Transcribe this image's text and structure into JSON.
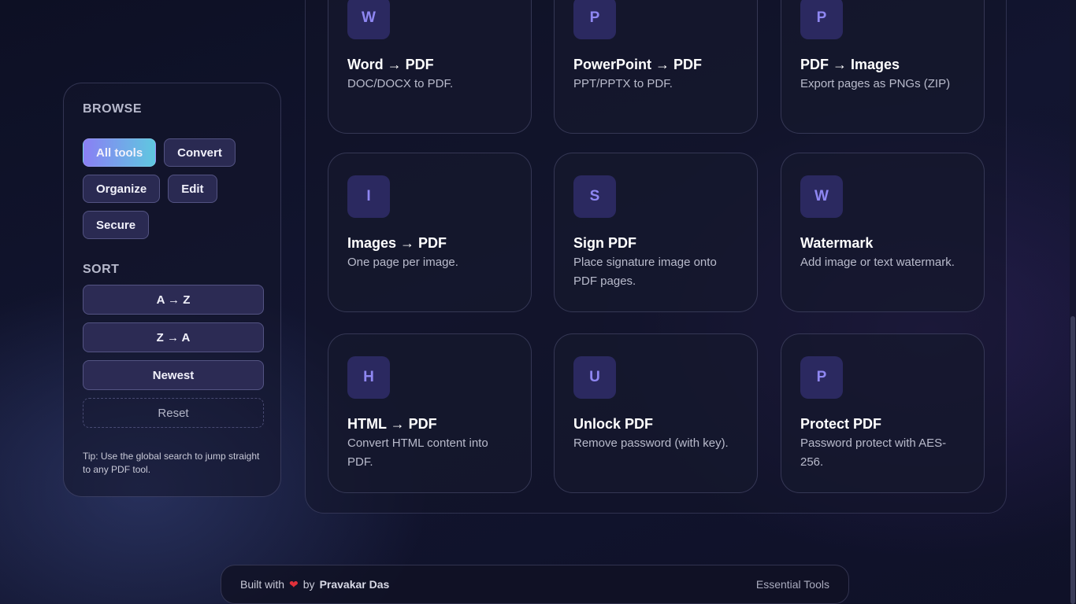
{
  "sidebar": {
    "browse_title": "BROWSE",
    "filters": [
      {
        "label": "All tools",
        "active": true
      },
      {
        "label": "Convert",
        "active": false
      },
      {
        "label": "Organize",
        "active": false
      },
      {
        "label": "Edit",
        "active": false
      },
      {
        "label": "Secure",
        "active": false
      }
    ],
    "sort_title": "SORT",
    "sort_az": "A → Z",
    "sort_za": "Z → A",
    "sort_newest": "Newest",
    "reset": "Reset",
    "tip": "Tip: Use the global search to jump straight to any PDF tool."
  },
  "tools": [
    {
      "letter": "W",
      "title": "Word → PDF",
      "desc": "DOC/DOCX to PDF."
    },
    {
      "letter": "P",
      "title": "PowerPoint → PDF",
      "desc": "PPT/PPTX to PDF."
    },
    {
      "letter": "P",
      "title": "PDF → Images",
      "desc": "Export pages as PNGs (ZIP)"
    },
    {
      "letter": "I",
      "title": "Images → PDF",
      "desc": "One page per image."
    },
    {
      "letter": "S",
      "title": "Sign PDF",
      "desc": "Place signature image onto PDF pages."
    },
    {
      "letter": "W",
      "title": "Watermark",
      "desc": "Add image or text watermark."
    },
    {
      "letter": "H",
      "title": "HTML → PDF",
      "desc": "Convert HTML content into PDF."
    },
    {
      "letter": "U",
      "title": "Unlock PDF",
      "desc": "Remove password (with key)."
    },
    {
      "letter": "P",
      "title": "Protect PDF",
      "desc": "Password protect with AES-256."
    }
  ],
  "footer": {
    "built_with": "Built with",
    "heart": "❤",
    "by": "by",
    "author": "Pravakar Das",
    "right": "Essential Tools"
  },
  "colors": {
    "accent_gradient_start": "#8a7ff4",
    "accent_gradient_end": "#5fc8e0",
    "tile_bg": "#2b2960",
    "tile_letter": "#8f87f2",
    "heart": "#e0303a"
  }
}
